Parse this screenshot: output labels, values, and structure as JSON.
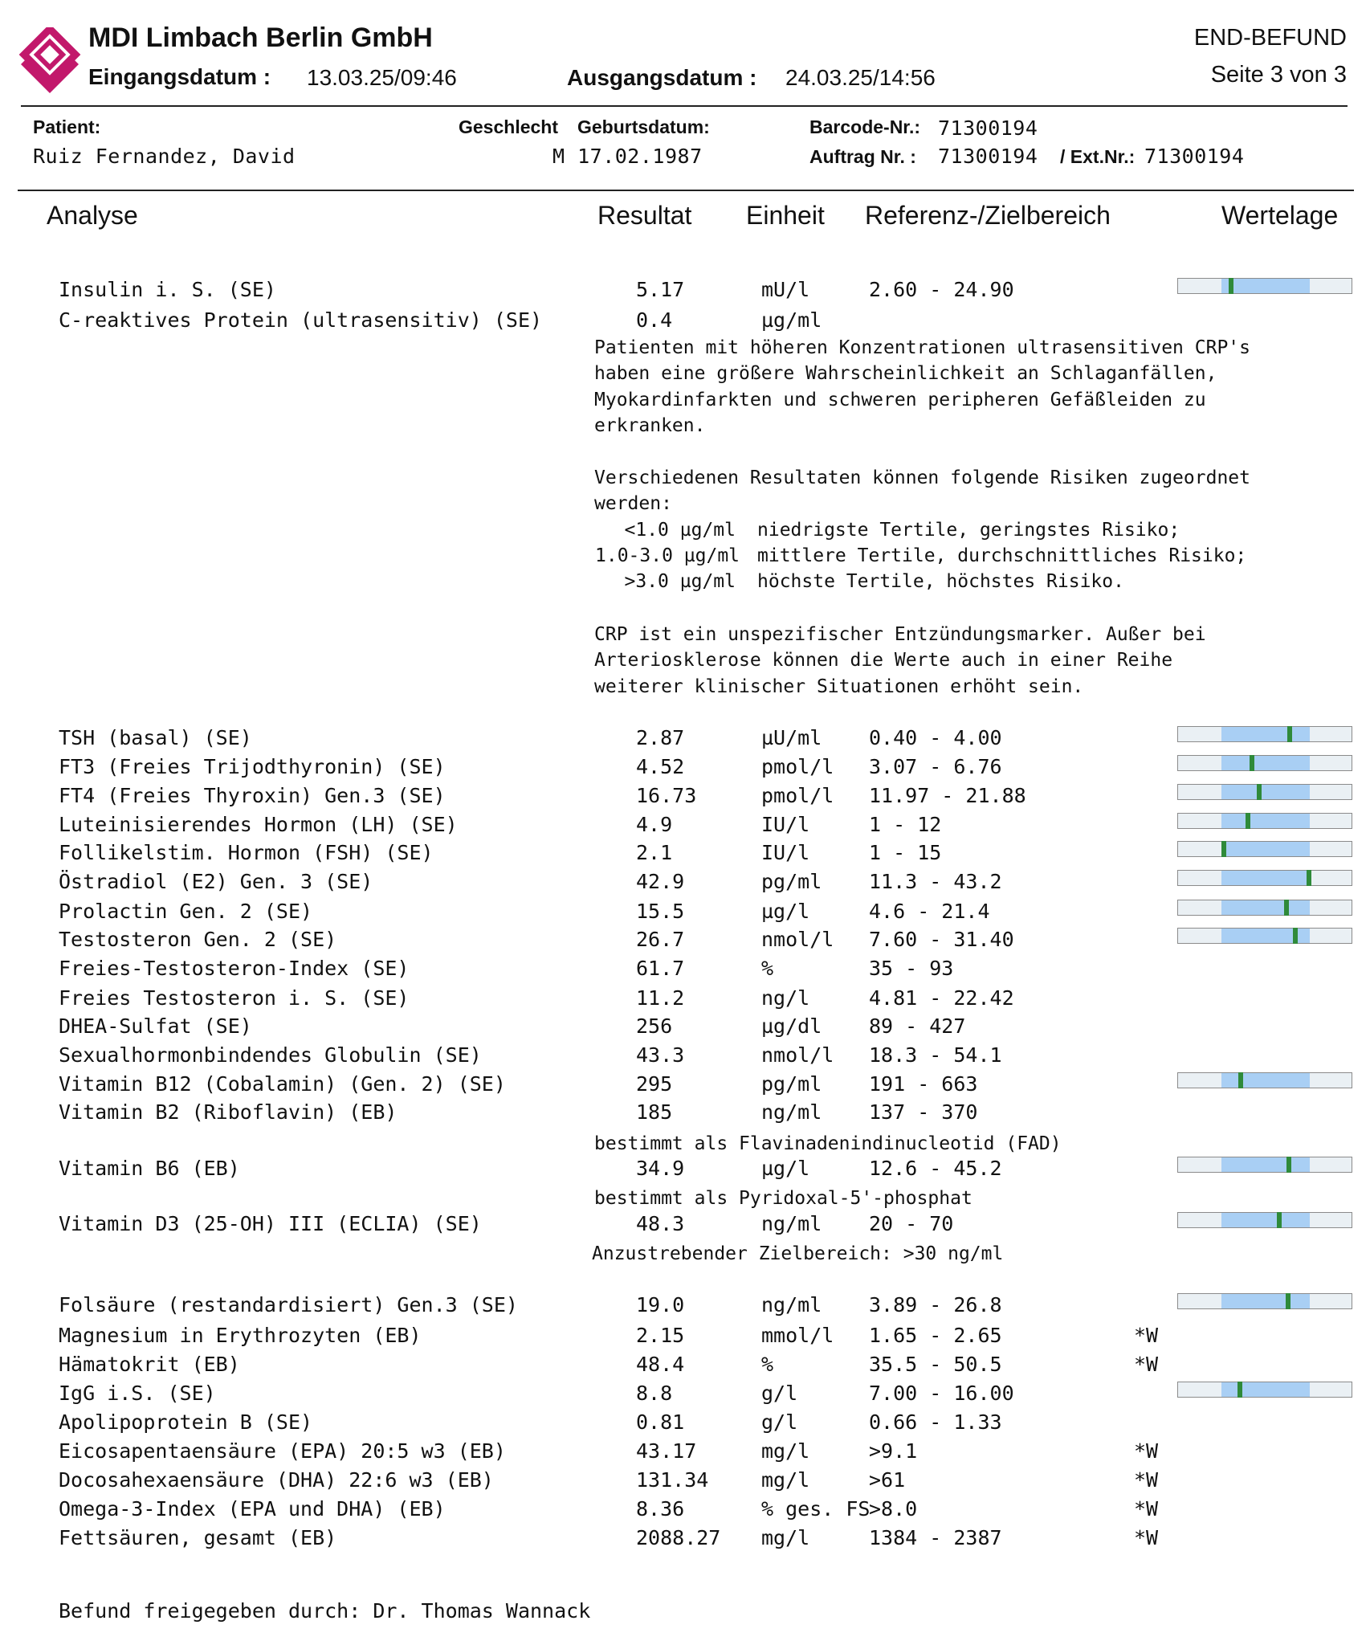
{
  "header": {
    "company": "MDI Limbach Berlin GmbH",
    "eingang_label": "Eingangsdatum :",
    "eingang_value": "13.03.25/09:46",
    "ausgang_label": "Ausgangsdatum :",
    "ausgang_value": "24.03.25/14:56",
    "status": "END-BEFUND",
    "page": "Seite 3 von 3",
    "logo_color": "#c2186b"
  },
  "patient": {
    "patient_label": "Patient:",
    "name": "Ruiz Fernandez, David",
    "gender_label": "Geschlecht",
    "birth_label": "Geburtsdatum:",
    "gender_birth": "M 17.02.1987",
    "barcode_label": "Barcode-Nr.:",
    "barcode": "71300194",
    "auftrag_label": "Auftrag Nr. :",
    "auftrag": "71300194",
    "ext_label": "/ Ext.Nr.:",
    "ext": "71300194"
  },
  "columns": {
    "analyse": "Analyse",
    "resultat": "Resultat",
    "einheit": "Einheit",
    "referenz": "Referenz-/Zielbereich",
    "wertelage": "Wertelage"
  },
  "results": [
    {
      "name": "Insulin i. S. (SE)",
      "result": "5.17",
      "unit": "mU/l",
      "ref": "2.60 - 24.90",
      "flag": "",
      "position": 0.306
    },
    {
      "name": "C-reaktives Protein (ultrasensitiv) (SE)",
      "result": "0.4",
      "unit": "µg/ml",
      "ref": "",
      "flag": ""
    },
    {
      "name": "TSH (basal) (SE)",
      "result": "2.87",
      "unit": "µU/ml",
      "ref": "0.40 - 4.00",
      "flag": "",
      "position": 0.647
    },
    {
      "name": "FT3 (Freies Trijodthyronin) (SE)",
      "result": "4.52",
      "unit": "pmol/l",
      "ref": "3.07 - 6.76",
      "flag": "",
      "position": 0.428
    },
    {
      "name": "FT4 (Freies Thyroxin) Gen.3 (SE)",
      "result": "16.73",
      "unit": "pmol/l",
      "ref": "11.97 - 21.88",
      "flag": "",
      "position": 0.472
    },
    {
      "name": "Luteinisierendes Hormon (LH) (SE)",
      "result": "4.9",
      "unit": "IU/l",
      "ref": "1 - 12",
      "flag": "",
      "position": 0.404
    },
    {
      "name": "Follikelstim. Hormon (FSH) (SE)",
      "result": "2.1",
      "unit": "IU/l",
      "ref": "1 - 15",
      "flag": "",
      "position": 0.264
    },
    {
      "name": "Östradiol (E2) Gen. 3 (SE)",
      "result": "42.9",
      "unit": "pg/ml",
      "ref": "11.3 - 43.2",
      "flag": "",
      "position": 0.758
    },
    {
      "name": "Prolactin Gen. 2 (SE)",
      "result": "15.5",
      "unit": "µg/l",
      "ref": "4.6 - 21.4",
      "flag": "",
      "position": 0.628
    },
    {
      "name": "Testosteron Gen. 2 (SE)",
      "result": "26.7",
      "unit": "nmol/l",
      "ref": "7.60 - 31.40",
      "flag": "",
      "position": 0.681
    },
    {
      "name": "Freies-Testosteron-Index (SE)",
      "result": "61.7",
      "unit": "%",
      "ref": "35 - 93",
      "flag": ""
    },
    {
      "name": "Freies Testosteron i. S. (SE)",
      "result": "11.2",
      "unit": "ng/l",
      "ref": "4.81 - 22.42",
      "flag": ""
    },
    {
      "name": "DHEA-Sulfat (SE)",
      "result": "256",
      "unit": "µg/dl",
      "ref": "89 - 427",
      "flag": ""
    },
    {
      "name": "Sexualhormonbindendes Globulin (SE)",
      "result": "43.3",
      "unit": "nmol/l",
      "ref": "18.3 - 54.1",
      "flag": ""
    },
    {
      "name": "Vitamin B12 (Cobalamin) (Gen. 2) (SE)",
      "result": "295",
      "unit": "pg/ml",
      "ref": "191 - 663",
      "flag": "",
      "position": 0.363
    },
    {
      "name": "Vitamin B2 (Riboflavin) (EB)",
      "result": "185",
      "unit": "ng/ml",
      "ref": "137 - 370",
      "flag": ""
    },
    {
      "name": "Vitamin B6 (EB)",
      "result": "34.9",
      "unit": "µg/l",
      "ref": "12.6 - 45.2",
      "flag": "",
      "position": 0.643
    },
    {
      "name": "Vitamin D3 (25-OH) III (ECLIA) (SE)",
      "result": "48.3",
      "unit": "ng/ml",
      "ref": "20 - 70",
      "flag": "",
      "position": 0.587
    },
    {
      "name": "Folsäure (restandardisiert) Gen.3 (SE)",
      "result": "19.0",
      "unit": "ng/ml",
      "ref": "3.89 - 26.8",
      "flag": "",
      "position": 0.638
    },
    {
      "name": "Magnesium in Erythrozyten (EB)",
      "result": "2.15",
      "unit": "mmol/l",
      "ref": "1.65 - 2.65",
      "flag": "*W"
    },
    {
      "name": "Hämatokrit (EB)",
      "result": "48.4",
      "unit": "%",
      "ref": "35.5 - 50.5",
      "flag": "*W"
    },
    {
      "name": "IgG i.S. (SE)",
      "result": "8.8",
      "unit": "g/l",
      "ref": "7.00 - 16.00",
      "flag": "",
      "position": 0.358
    },
    {
      "name": "Apolipoprotein B (SE)",
      "result": "0.81",
      "unit": "g/l",
      "ref": "0.66 - 1.33",
      "flag": ""
    },
    {
      "name": "Eicosapentaensäure (EPA) 20:5 w3 (EB)",
      "result": "43.17",
      "unit": "mg/l",
      "ref": ">9.1",
      "flag": "*W"
    },
    {
      "name": "Docosahexaensäure (DHA) 22:6 w3 (EB)",
      "result": "131.34",
      "unit": "mg/l",
      "ref": ">61",
      "flag": "*W"
    },
    {
      "name": "Omega-3-Index (EPA und DHA) (EB)",
      "result": "8.36",
      "unit": "% ges. FS",
      "ref": ">8.0",
      "flag": "*W"
    },
    {
      "name": "Fettsäuren, gesamt (EB)",
      "result": "2088.27",
      "unit": "mg/l",
      "ref": "1384 - 2387",
      "flag": "*W"
    }
  ],
  "crp_comment": {
    "p1": [
      "Patienten mit höheren Konzentrationen ultrasensitiven CRP's",
      "haben eine größere Wahrscheinlichkeit an Schlaganfällen,",
      "Myokardinfarkten und schweren peripheren Gefäßleiden zu",
      "erkranken."
    ],
    "p2": [
      "Verschiedenen Resultaten können folgende Risiken zugeordnet",
      "werden:"
    ],
    "risks": [
      {
        "range": "<1.0 µg/ml",
        "text": "niedrigste Tertile, geringstes Risiko;"
      },
      {
        "range": "1.0-3.0 µg/ml",
        "text": "mittlere Tertile, durchschnittliches Risiko;"
      },
      {
        "range": ">3.0 µg/ml",
        "text": "höchste Tertile, höchstes Risiko."
      }
    ],
    "p3": [
      "CRP ist ein unspezifischer Entzündungsmarker. Außer bei",
      "Arteriosklerose können die Werte auch in einer Reihe",
      "weiterer klinischer Situationen erhöht sein."
    ]
  },
  "notes": {
    "b2": "bestimmt als Flavinadenindinucleotid (FAD)",
    "b6": "bestimmt als Pyridoxal-5'-phosphat",
    "d3": "Anzustrebender Zielbereich: >30 ng/ml"
  },
  "footer": {
    "released": "Befund freigegeben durch: Dr. Thomas Wannack"
  }
}
